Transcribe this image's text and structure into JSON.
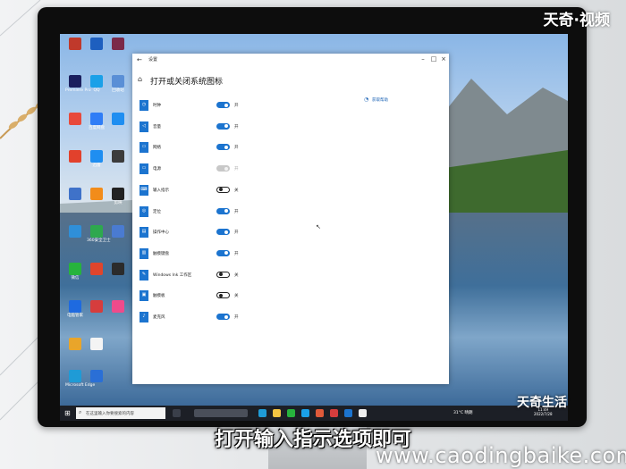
{
  "watermark": {
    "top_right": "天奇·视频",
    "logo": "天奇生活",
    "url": "www.caodingbaike.com"
  },
  "subtitle": "打开输入指示选项即可",
  "window": {
    "title": "设置",
    "page_title": "打开或关闭系统图标",
    "help_link": "获取帮助",
    "rows": [
      {
        "name": "时钟",
        "state": "开",
        "mode": "on"
      },
      {
        "name": "音量",
        "state": "开",
        "mode": "on"
      },
      {
        "name": "网络",
        "state": "开",
        "mode": "on"
      },
      {
        "name": "电源",
        "state": "开",
        "mode": "disabled"
      },
      {
        "name": "输入指示",
        "state": "关",
        "mode": "off"
      },
      {
        "name": "定位",
        "state": "开",
        "mode": "on"
      },
      {
        "name": "操作中心",
        "state": "开",
        "mode": "on"
      },
      {
        "name": "触摸键盘",
        "state": "开",
        "mode": "on"
      },
      {
        "name": "Windows Ink 工作区",
        "state": "关",
        "mode": "off"
      },
      {
        "name": "触摸板",
        "state": "关",
        "mode": "off"
      },
      {
        "name": "麦克风",
        "state": "开",
        "mode": "on"
      }
    ]
  },
  "taskbar": {
    "search_placeholder": "在这里输入你要搜索的内容",
    "tray_text": "31°C 晴朗",
    "clock_time": "11:49",
    "clock_date": "2022/7/28"
  },
  "desktop_icons": [
    {
      "label": "Premiere Pro",
      "color": "#1b1f5e"
    },
    {
      "label": "QQ",
      "color": "#1aa0e8"
    },
    {
      "label": "回收站",
      "color": "#5a8fd6"
    },
    {
      "label": "百度网盘",
      "color": "#2f7df6"
    },
    {
      "label": "迅雷",
      "color": "#1f8ef1"
    },
    {
      "label": "剪映",
      "color": "#222222"
    },
    {
      "label": "微信",
      "color": "#27b33d"
    },
    {
      "label": "360安全卫士",
      "color": "#2ea84e"
    },
    {
      "label": "电脑管家",
      "color": "#1e6ae0"
    },
    {
      "label": "Microsoft Edge",
      "color": "#1f9bd6"
    }
  ]
}
